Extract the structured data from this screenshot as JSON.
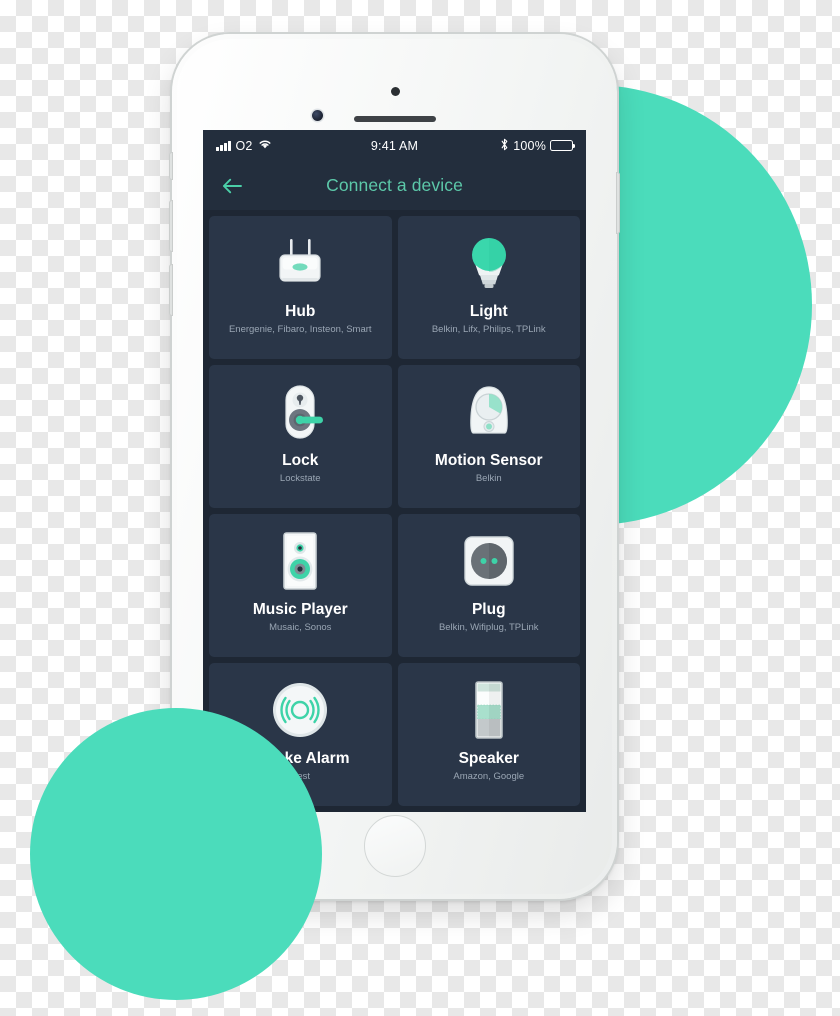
{
  "theme": {
    "accent_teal": "#4bdcbb",
    "screen_bg": "#1e2734",
    "card_bg": "#2a3648",
    "bar_bg": "#232e3d",
    "title_color": "#5cc8a9",
    "subtitle_color": "#9aa6b4"
  },
  "status_bar": {
    "carrier": "O2",
    "wifi_icon": "wifi-icon",
    "signal_icon": "signal-bars-icon",
    "time": "9:41 AM",
    "bluetooth_icon": "bluetooth-icon",
    "battery_percent": "100%",
    "battery_icon": "battery-full-icon"
  },
  "nav_bar": {
    "back_icon": "arrow-left-icon",
    "title": "Connect a device"
  },
  "devices": [
    {
      "icon": "hub-router-icon",
      "title": "Hub",
      "subtitle": "Energenie, Fibaro, Insteon, Smart"
    },
    {
      "icon": "light-bulb-icon",
      "title": "Light",
      "subtitle": "Belkin, Lifx, Philips, TPLink"
    },
    {
      "icon": "door-lock-icon",
      "title": "Lock",
      "subtitle": "Lockstate"
    },
    {
      "icon": "motion-sensor-icon",
      "title": "Motion Sensor",
      "subtitle": "Belkin"
    },
    {
      "icon": "music-player-icon",
      "title": "Music Player",
      "subtitle": "Musaic, Sonos"
    },
    {
      "icon": "power-plug-socket-icon",
      "title": "Plug",
      "subtitle": "Belkin, Wifiplug, TPLink"
    },
    {
      "icon": "smoke-alarm-icon",
      "title": "Smoke Alarm",
      "subtitle": "Nest"
    },
    {
      "icon": "speaker-icon",
      "title": "Speaker",
      "subtitle": "Amazon, Google"
    }
  ],
  "hardware": {
    "earpiece": "earpiece-speaker",
    "front_camera": "front-camera",
    "proximity_sensor": "proximity-sensor",
    "home_button": "home-button",
    "power_button": "power-button",
    "silent_switch": "silent-switch",
    "volume_up": "volume-up-button",
    "volume_down": "volume-down-button"
  }
}
